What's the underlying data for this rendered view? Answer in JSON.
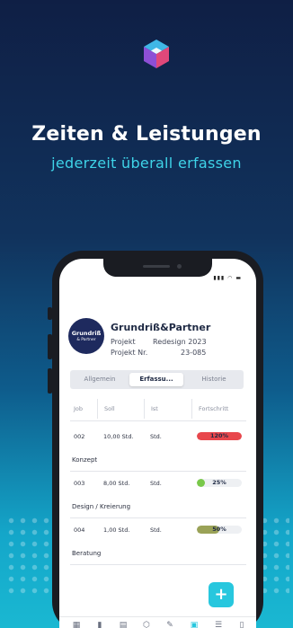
{
  "headline": "Zeiten & Leistungen",
  "subline": "jederzeit überall erfassen",
  "colors": {
    "accent": "#27c7de",
    "navy": "#1e2a5e",
    "red": "#e8474c",
    "green": "#79c84a",
    "olive": "#9aa257"
  },
  "company": {
    "logo_line1": "Grundriß",
    "logo_line2": "& Partner",
    "name": "Grundriß&Partner",
    "project_label": "Projekt",
    "project_value": "Redesign 2023",
    "project_nr_label": "Projekt Nr.",
    "project_nr_value": "23-085"
  },
  "tabs": [
    {
      "label": "Allgemein"
    },
    {
      "label": "Erfassu..."
    },
    {
      "label": "Historie"
    }
  ],
  "table": {
    "headers": [
      "Job",
      "Soll",
      "Ist",
      "Fortschritt"
    ],
    "rows": [
      {
        "job": "002",
        "soll": "10,00 Std.",
        "ist": "Std.",
        "progress_label": "120%",
        "progress": 1.2,
        "color": "#e8474c",
        "description": "Konzept"
      },
      {
        "job": "003",
        "soll": "8,00 Std.",
        "ist": "Std.",
        "progress_label": "25%",
        "progress": 0.25,
        "color": "#79c84a",
        "description": "Design / Kreierung"
      },
      {
        "job": "004",
        "soll": "1,00 Std.",
        "ist": "Std.",
        "progress_label": "50%",
        "progress": 0.5,
        "color": "#9aa257",
        "description": "Beratung"
      }
    ]
  },
  "fab_label": "+",
  "nav_icons": [
    "calendar-grid-icon",
    "bar-chart-icon",
    "calendar-icon",
    "cube-icon",
    "pencil-icon",
    "briefcase-icon",
    "list-icon",
    "document-icon"
  ]
}
